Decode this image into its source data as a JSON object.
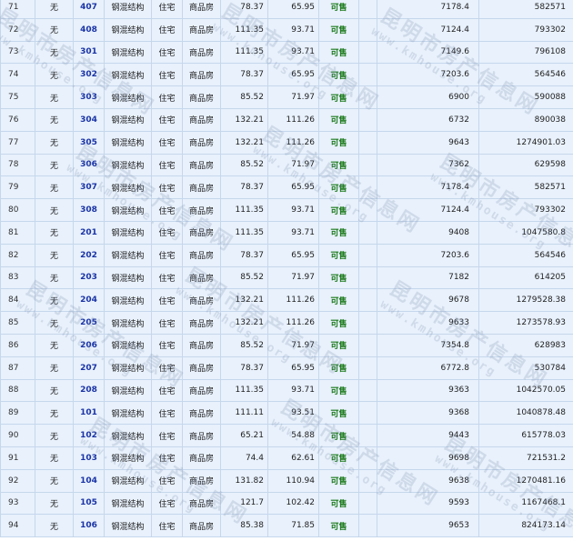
{
  "rows": [
    {
      "idx": "71",
      "mort": "无",
      "room": "407",
      "struct": "钢混结构",
      "use": "住宅",
      "type": "商品房",
      "area": "78.37",
      "inner": "65.95",
      "status": "可售",
      "price": "7178.4",
      "total": "582571"
    },
    {
      "idx": "72",
      "mort": "无",
      "room": "408",
      "struct": "钢混结构",
      "use": "住宅",
      "type": "商品房",
      "area": "111.35",
      "inner": "93.71",
      "status": "可售",
      "price": "7124.4",
      "total": "793302"
    },
    {
      "idx": "73",
      "mort": "无",
      "room": "301",
      "struct": "钢混结构",
      "use": "住宅",
      "type": "商品房",
      "area": "111.35",
      "inner": "93.71",
      "status": "可售",
      "price": "7149.6",
      "total": "796108"
    },
    {
      "idx": "74",
      "mort": "无",
      "room": "302",
      "struct": "钢混结构",
      "use": "住宅",
      "type": "商品房",
      "area": "78.37",
      "inner": "65.95",
      "status": "可售",
      "price": "7203.6",
      "total": "564546"
    },
    {
      "idx": "75",
      "mort": "无",
      "room": "303",
      "struct": "钢混结构",
      "use": "住宅",
      "type": "商品房",
      "area": "85.52",
      "inner": "71.97",
      "status": "可售",
      "price": "6900",
      "total": "590088"
    },
    {
      "idx": "76",
      "mort": "无",
      "room": "304",
      "struct": "钢混结构",
      "use": "住宅",
      "type": "商品房",
      "area": "132.21",
      "inner": "111.26",
      "status": "可售",
      "price": "6732",
      "total": "890038"
    },
    {
      "idx": "77",
      "mort": "无",
      "room": "305",
      "struct": "钢混结构",
      "use": "住宅",
      "type": "商品房",
      "area": "132.21",
      "inner": "111.26",
      "status": "可售",
      "price": "9643",
      "total": "1274901.03"
    },
    {
      "idx": "78",
      "mort": "无",
      "room": "306",
      "struct": "钢混结构",
      "use": "住宅",
      "type": "商品房",
      "area": "85.52",
      "inner": "71.97",
      "status": "可售",
      "price": "7362",
      "total": "629598"
    },
    {
      "idx": "79",
      "mort": "无",
      "room": "307",
      "struct": "钢混结构",
      "use": "住宅",
      "type": "商品房",
      "area": "78.37",
      "inner": "65.95",
      "status": "可售",
      "price": "7178.4",
      "total": "582571"
    },
    {
      "idx": "80",
      "mort": "无",
      "room": "308",
      "struct": "钢混结构",
      "use": "住宅",
      "type": "商品房",
      "area": "111.35",
      "inner": "93.71",
      "status": "可售",
      "price": "7124.4",
      "total": "793302"
    },
    {
      "idx": "81",
      "mort": "无",
      "room": "201",
      "struct": "钢混结构",
      "use": "住宅",
      "type": "商品房",
      "area": "111.35",
      "inner": "93.71",
      "status": "可售",
      "price": "9408",
      "total": "1047580.8"
    },
    {
      "idx": "82",
      "mort": "无",
      "room": "202",
      "struct": "钢混结构",
      "use": "住宅",
      "type": "商品房",
      "area": "78.37",
      "inner": "65.95",
      "status": "可售",
      "price": "7203.6",
      "total": "564546"
    },
    {
      "idx": "83",
      "mort": "无",
      "room": "203",
      "struct": "钢混结构",
      "use": "住宅",
      "type": "商品房",
      "area": "85.52",
      "inner": "71.97",
      "status": "可售",
      "price": "7182",
      "total": "614205"
    },
    {
      "idx": "84",
      "mort": "无",
      "room": "204",
      "struct": "钢混结构",
      "use": "住宅",
      "type": "商品房",
      "area": "132.21",
      "inner": "111.26",
      "status": "可售",
      "price": "9678",
      "total": "1279528.38"
    },
    {
      "idx": "85",
      "mort": "无",
      "room": "205",
      "struct": "钢混结构",
      "use": "住宅",
      "type": "商品房",
      "area": "132.21",
      "inner": "111.26",
      "status": "可售",
      "price": "9633",
      "total": "1273578.93"
    },
    {
      "idx": "86",
      "mort": "无",
      "room": "206",
      "struct": "钢混结构",
      "use": "住宅",
      "type": "商品房",
      "area": "85.52",
      "inner": "71.97",
      "status": "可售",
      "price": "7354.8",
      "total": "628983"
    },
    {
      "idx": "87",
      "mort": "无",
      "room": "207",
      "struct": "钢混结构",
      "use": "住宅",
      "type": "商品房",
      "area": "78.37",
      "inner": "65.95",
      "status": "可售",
      "price": "6772.8",
      "total": "530784"
    },
    {
      "idx": "88",
      "mort": "无",
      "room": "208",
      "struct": "钢混结构",
      "use": "住宅",
      "type": "商品房",
      "area": "111.35",
      "inner": "93.71",
      "status": "可售",
      "price": "9363",
      "total": "1042570.05"
    },
    {
      "idx": "89",
      "mort": "无",
      "room": "101",
      "struct": "钢混结构",
      "use": "住宅",
      "type": "商品房",
      "area": "111.11",
      "inner": "93.51",
      "status": "可售",
      "price": "9368",
      "total": "1040878.48"
    },
    {
      "idx": "90",
      "mort": "无",
      "room": "102",
      "struct": "钢混结构",
      "use": "住宅",
      "type": "商品房",
      "area": "65.21",
      "inner": "54.88",
      "status": "可售",
      "price": "9443",
      "total": "615778.03"
    },
    {
      "idx": "91",
      "mort": "无",
      "room": "103",
      "struct": "钢混结构",
      "use": "住宅",
      "type": "商品房",
      "area": "74.4",
      "inner": "62.61",
      "status": "可售",
      "price": "9698",
      "total": "721531.2"
    },
    {
      "idx": "92",
      "mort": "无",
      "room": "104",
      "struct": "钢混结构",
      "use": "住宅",
      "type": "商品房",
      "area": "131.82",
      "inner": "110.94",
      "status": "可售",
      "price": "9638",
      "total": "1270481.16"
    },
    {
      "idx": "93",
      "mort": "无",
      "room": "105",
      "struct": "钢混结构",
      "use": "住宅",
      "type": "商品房",
      "area": "121.7",
      "inner": "102.42",
      "status": "可售",
      "price": "9593",
      "total": "1167468.1"
    },
    {
      "idx": "94",
      "mort": "无",
      "room": "106",
      "struct": "钢混结构",
      "use": "住宅",
      "type": "商品房",
      "area": "85.38",
      "inner": "71.85",
      "status": "可售",
      "price": "9653",
      "total": "824173.14"
    }
  ],
  "watermark": {
    "text": "昆明市房产信息网",
    "url": "www.kmhouse.org"
  },
  "colors": {
    "cell_bg": "#e8f1fc",
    "border": "#c6d7ec",
    "room_link": "#1a33a6",
    "status_ok": "#1c7a1c"
  }
}
